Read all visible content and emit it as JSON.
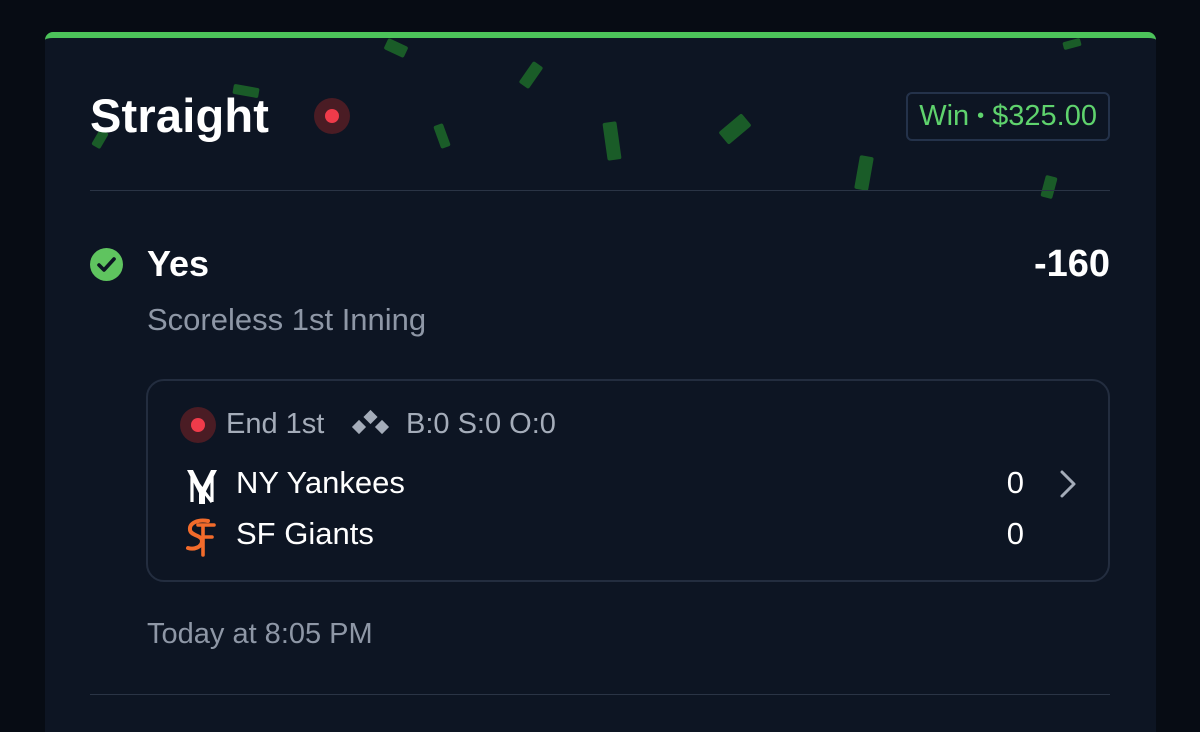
{
  "bet": {
    "type_label": "Straight",
    "result_label": "Win",
    "result_separator": "•",
    "payout": "$325.00",
    "pick": "Yes",
    "odds": "-160",
    "market": "Scoreless 1st Inning",
    "placed_time": "Today at 8:05 PM"
  },
  "game": {
    "status": "End 1st",
    "count": "B:0 S:0 O:0",
    "teams": [
      {
        "name": "NY Yankees",
        "score": "0",
        "logo": "yankees-logo"
      },
      {
        "name": "SF Giants",
        "score": "0",
        "logo": "giants-logo"
      }
    ]
  },
  "colors": {
    "accent_green": "#4cc35a",
    "live_red": "#ef3b4a",
    "card_bg": "#0d1523",
    "giants_orange": "#f26b2b"
  }
}
